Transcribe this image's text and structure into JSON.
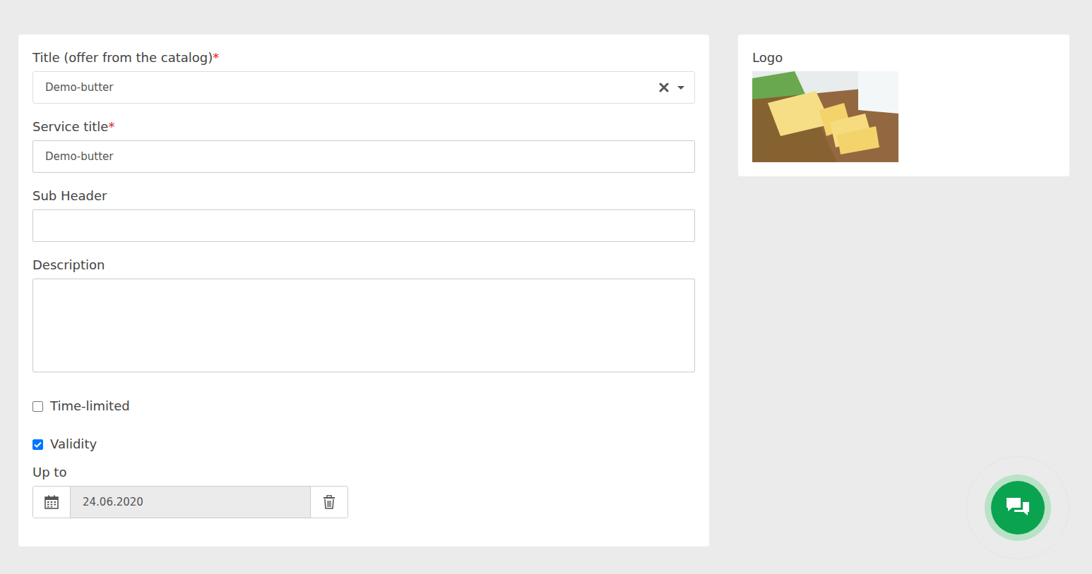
{
  "form": {
    "title_field": {
      "label": "Title (offer from the catalog)",
      "required": "*",
      "value": "Demo-butter"
    },
    "service_title": {
      "label": "Service title",
      "required": "*",
      "value": "Demo-butter"
    },
    "sub_header": {
      "label": "Sub Header"
    },
    "description": {
      "label": "Description"
    },
    "checkboxes": [
      {
        "label": "Time-limited",
        "checked": false
      },
      {
        "label": "Validity",
        "checked": true
      }
    ],
    "up_to": {
      "label": "Up to",
      "value": "24.06.2020"
    }
  },
  "logo": {
    "label": "Logo"
  }
}
